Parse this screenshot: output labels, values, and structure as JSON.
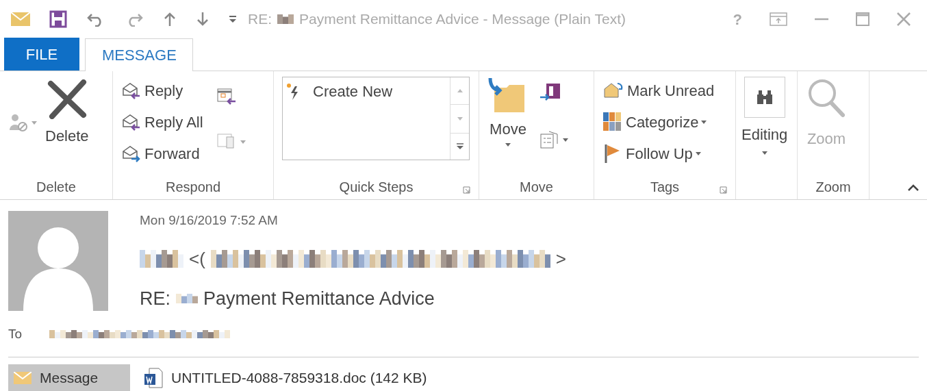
{
  "title_bar": {
    "prefix": "RE:",
    "title": "Payment Remittance Advice - Message (Plain Text)",
    "help": "?"
  },
  "tabs": [
    {
      "label": "FILE",
      "kind": "file",
      "selected": false
    },
    {
      "label": "MESSAGE",
      "kind": "tab",
      "selected": true
    }
  ],
  "ribbon": {
    "delete": {
      "label": "Delete",
      "button": "Delete"
    },
    "respond": {
      "label": "Respond",
      "items": [
        "Reply",
        "Reply All",
        "Forward"
      ]
    },
    "quick_steps": {
      "label": "Quick Steps",
      "items": [
        "Create New"
      ]
    },
    "move": {
      "label": "Move",
      "button": "Move"
    },
    "tags": {
      "label": "Tags",
      "items": [
        {
          "label": "Mark Unread",
          "dropdown": false
        },
        {
          "label": "Categorize",
          "dropdown": true
        },
        {
          "label": "Follow Up",
          "dropdown": true
        }
      ]
    },
    "editing": {
      "button": "Editing"
    },
    "zoom": {
      "label": "Zoom",
      "button": "Zoom",
      "disabled": true
    }
  },
  "message": {
    "date": "Mon 9/16/2019 7:52 AM",
    "sender_open": "<(",
    "sender_close": ">",
    "subject_prefix": "RE:",
    "subject": "Payment Remittance Advice",
    "to_label": "To",
    "attachments": [
      {
        "label": "Message",
        "kind": "message",
        "selected": true
      },
      {
        "label": "UNTITLED-4088-7859318.doc (142 KB)",
        "kind": "word",
        "selected": false
      }
    ]
  }
}
